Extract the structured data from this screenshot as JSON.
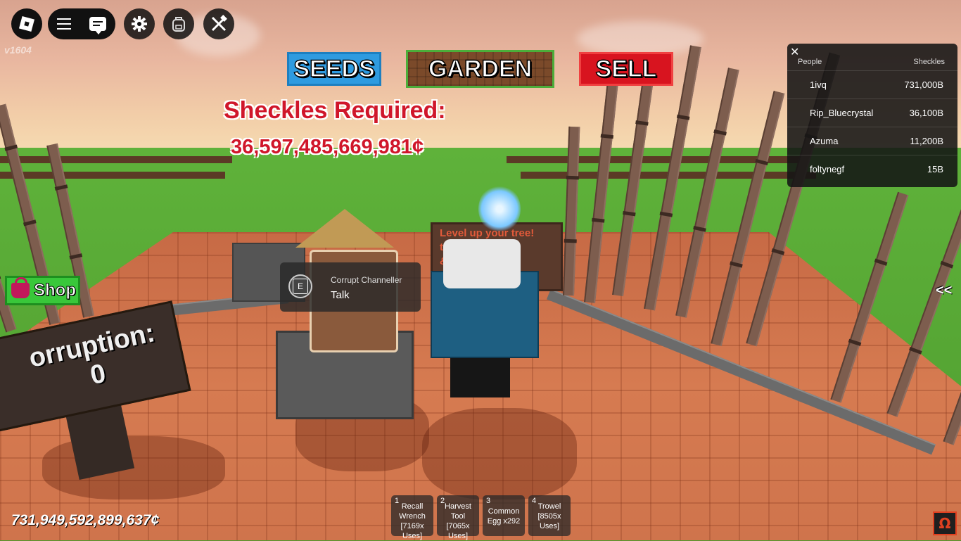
{
  "app": {
    "version": "v1604"
  },
  "nav": {
    "seeds": "SEEDS",
    "garden": "GARDEN",
    "sell": "SELL"
  },
  "requirement": {
    "title": "Sheckles Required:",
    "value": "36,597,485,669,981¢"
  },
  "leaderboard": {
    "headers": {
      "people": "People",
      "currency": "Sheckles"
    },
    "rows": [
      {
        "name": "1ivq",
        "value": "731,000B"
      },
      {
        "name": "Rip_Bluecrystal",
        "value": "36,100B"
      },
      {
        "name": "Azuma",
        "value": "11,200B"
      },
      {
        "name": "foltynegf",
        "value": "15B"
      }
    ]
  },
  "shop": {
    "label": "Shop"
  },
  "prompt": {
    "key": "E",
    "object": "Corrupt Channeller",
    "action": "Talk"
  },
  "world": {
    "corruption_sign": "orruption:\n0",
    "tree_sign": "Level up your tree!\nto get assets\n& options!"
  },
  "side_toggle": "<<",
  "hotbar": [
    {
      "num": "1",
      "name": "Recall\nWrench\n[7169x\nUses]"
    },
    {
      "num": "2",
      "name": "Harvest\nTool\n[7065x\nUses]"
    },
    {
      "num": "3",
      "name": "Common\nEgg x292"
    },
    {
      "num": "4",
      "name": "Trowel\n[8505x\nUses]"
    }
  ],
  "money": "731,949,592,899,637¢",
  "colors": {
    "seeds": "#2f9be0",
    "sell": "#d8141f",
    "shop": "#39c73a",
    "required_text": "#d0162a"
  },
  "icons": [
    "roblox-icon",
    "hamburger-icon",
    "chat-icon",
    "gear-icon",
    "backpack-icon",
    "tools-icon",
    "close-icon",
    "basket-icon",
    "omega-icon"
  ]
}
